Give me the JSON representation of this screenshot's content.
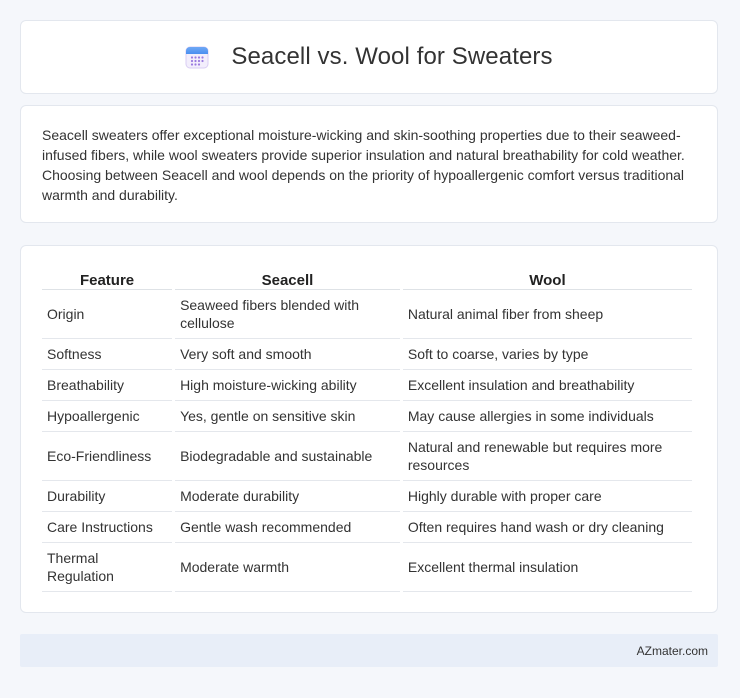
{
  "header": {
    "icon": "calendar-icon",
    "title": "Seacell vs. Wool for Sweaters"
  },
  "intro": {
    "text": "Seacell sweaters offer exceptional moisture-wicking and skin-soothing properties due to their seaweed-infused fibers, while wool sweaters provide superior insulation and natural breathability for cold weather. Choosing between Seacell and wool depends on the priority of hypoallergenic comfort versus traditional warmth and durability."
  },
  "table": {
    "headers": [
      "Feature",
      "Seacell",
      "Wool"
    ],
    "rows": [
      [
        "Origin",
        "Seaweed fibers blended with cellulose",
        "Natural animal fiber from sheep"
      ],
      [
        "Softness",
        "Very soft and smooth",
        "Soft to coarse, varies by type"
      ],
      [
        "Breathability",
        "High moisture-wicking ability",
        "Excellent insulation and breathability"
      ],
      [
        "Hypoallergenic",
        "Yes, gentle on sensitive skin",
        "May cause allergies in some individuals"
      ],
      [
        "Eco-Friendliness",
        "Biodegradable and sustainable",
        "Natural and renewable but requires more resources"
      ],
      [
        "Durability",
        "Moderate durability",
        "Highly durable with proper care"
      ],
      [
        "Care Instructions",
        "Gentle wash recommended",
        "Often requires hand wash or dry cleaning"
      ],
      [
        "Thermal Regulation",
        "Moderate warmth",
        "Excellent thermal insulation"
      ]
    ]
  },
  "footer": {
    "text": "AZmater.com"
  },
  "colors": {
    "page_background": "#f5f7fb",
    "card_background": "#ffffff",
    "footer_background": "#e8eef8",
    "icon_blue": "#4a8ff0",
    "icon_purple": "#9b7be0"
  }
}
